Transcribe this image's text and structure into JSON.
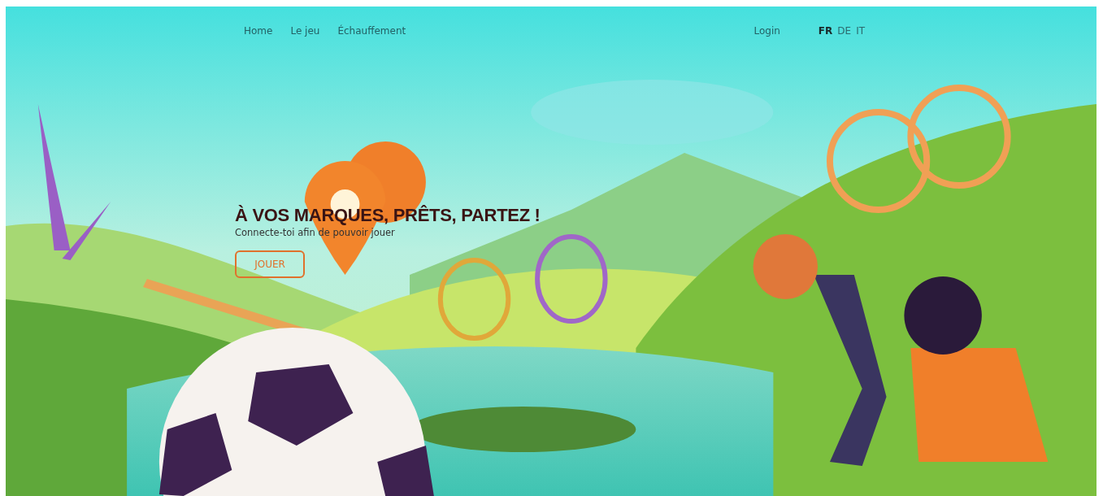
{
  "nav": {
    "links": [
      {
        "label": "Home"
      },
      {
        "label": "Le jeu"
      },
      {
        "label": "Échauffement"
      }
    ],
    "login": "Login",
    "languages": [
      {
        "label": "FR",
        "selected": true
      },
      {
        "label": "DE",
        "selected": false
      },
      {
        "label": "IT",
        "selected": false
      }
    ]
  },
  "hero": {
    "title": "À VOS MARQUES, PRÊTS, PARTEZ !",
    "subtitle": "Connecte-toi afin de pouvoir jouer",
    "button": "JOUER"
  }
}
